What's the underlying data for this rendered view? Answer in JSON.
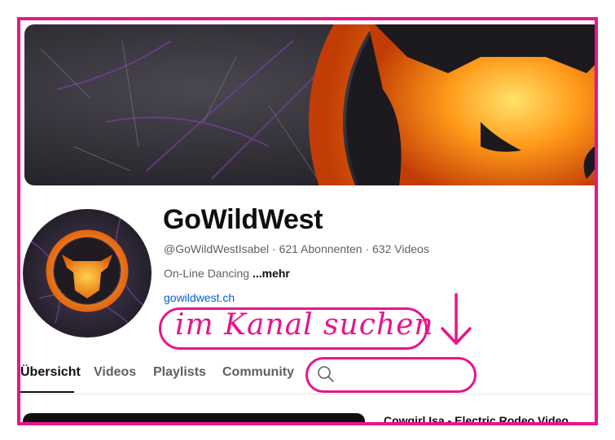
{
  "channel": {
    "name": "GoWildWest",
    "handle": "@GoWildWestIsabel",
    "meta_sep1": " · ",
    "subscribers": "621 Abonnenten",
    "meta_sep2": " · ",
    "videos": "632 Videos",
    "description": "On-Line Dancing ",
    "more_label": "...mehr",
    "link": "gowildwest.ch"
  },
  "annotation": {
    "text": "im Kanal suchen",
    "color": "#e6158c"
  },
  "tabs": [
    {
      "label": "Übersicht",
      "active": true
    },
    {
      "label": "Videos",
      "active": false
    },
    {
      "label": "Playlists",
      "active": false
    },
    {
      "label": "Community",
      "active": false
    }
  ],
  "search": {
    "placeholder": "",
    "icon": "search-icon"
  },
  "featured_video": {
    "title": "Cowgirl Isa - Electric Rodeo Video"
  },
  "colors": {
    "frame": "#e6158c",
    "link": "#065fd4",
    "banner_bg": "#2b2830",
    "bull_orange": "#f28a10"
  }
}
